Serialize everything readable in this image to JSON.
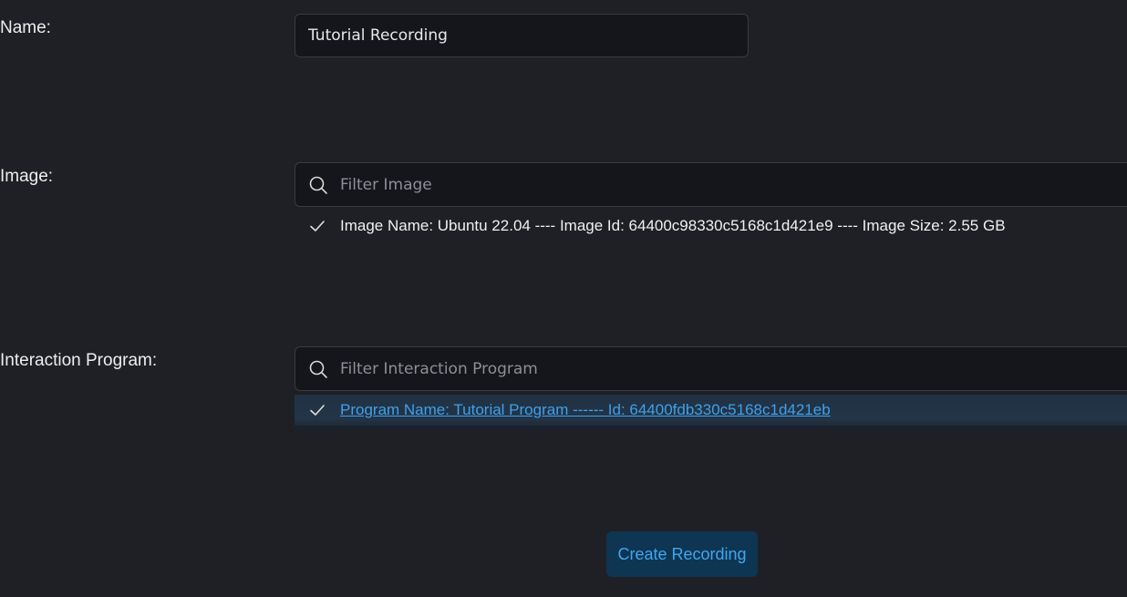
{
  "form": {
    "name": {
      "label": "Name:",
      "value": "Tutorial Recording"
    },
    "image": {
      "label": "Image:",
      "filter_placeholder": "Filter Image",
      "selected_option": "Image Name: Ubuntu 22.04 ---- Image Id: 64400c98330c5168c1d421e9 ---- Image Size: 2.55 GB"
    },
    "interaction_program": {
      "label": "Interaction Program:",
      "filter_placeholder": "Filter Interaction Program",
      "selected_option": "Program Name: Tutorial Program ------ Id: 64400fdb330c5168c1d421eb"
    },
    "submit_label": "Create Recording"
  },
  "icons": {
    "search": "search-icon",
    "check": "check-icon"
  },
  "colors": {
    "background": "#1f2025",
    "input_background": "#15161b",
    "link_blue": "#3fa0ec",
    "button_background": "#0e3552",
    "selected_row": "#223446"
  }
}
